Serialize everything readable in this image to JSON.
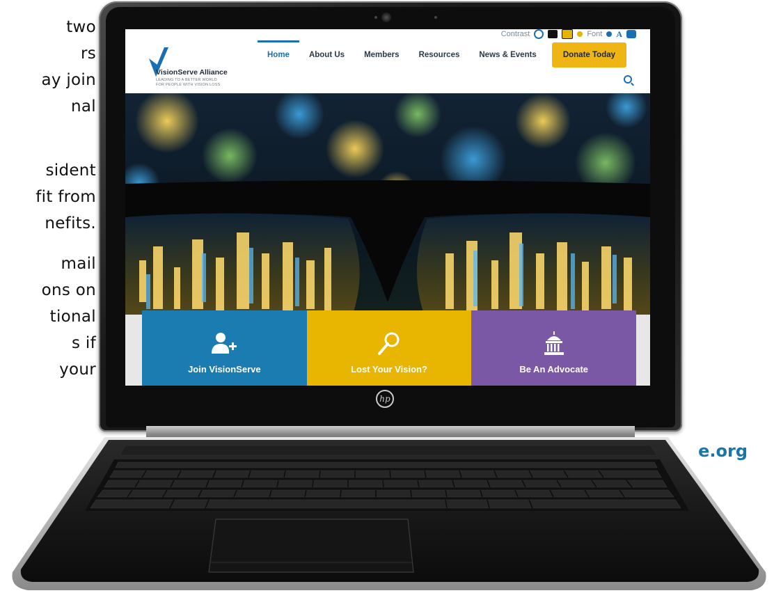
{
  "side_text": {
    "lines": [
      "two",
      "rs",
      "ay join",
      "nal",
      "sident",
      "fit from",
      "nefits.",
      "mail",
      "ons on",
      "tional",
      "s if",
      "your"
    ],
    "url": "e.org"
  },
  "website": {
    "toolbar": {
      "contrast_label": "Contrast",
      "font_label": "Font",
      "font_a": "A"
    },
    "logo": {
      "name": "VisionServe Alliance",
      "tagline_1": "LEADING TO A BETTER WORLD",
      "tagline_2": "FOR PEOPLE WITH VISION LOSS"
    },
    "nav": {
      "items": [
        "Home",
        "About Us",
        "Members",
        "Resources",
        "News & Events"
      ],
      "active": "Home",
      "donate_label": "Donate Today"
    },
    "tiles": [
      {
        "label": "Join VisionServe",
        "color": "#1b7cb2",
        "icon": "add-user-icon"
      },
      {
        "label": "Lost Your Vision?",
        "color": "#e8b500",
        "icon": "magnifier-icon"
      },
      {
        "label": "Be An Advocate",
        "color": "#7a58a6",
        "icon": "capitol-icon"
      }
    ]
  },
  "laptop": {
    "brand": "hp"
  },
  "colors": {
    "brand_blue": "#1a6fb3",
    "donate_yellow": "#efb515",
    "url_blue": "#1677a8"
  }
}
